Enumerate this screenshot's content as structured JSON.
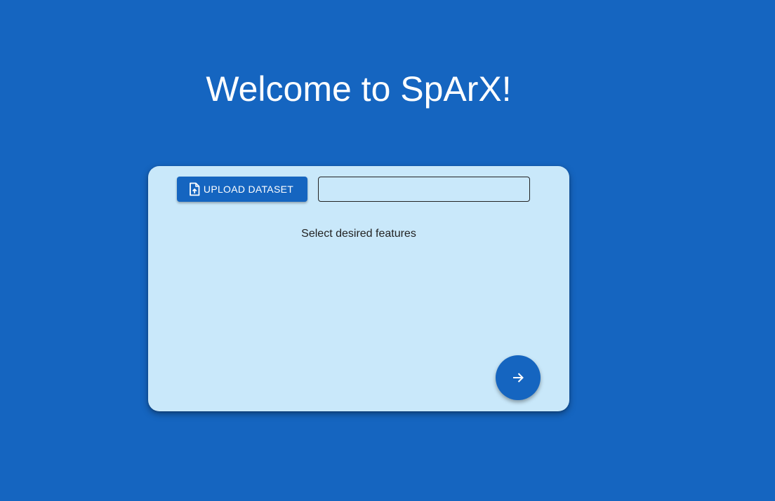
{
  "header": {
    "title": "Welcome to SpArX!"
  },
  "card": {
    "upload_button": {
      "label": "UPLOAD DATASET",
      "icon": "file-upload-icon"
    },
    "file_name_input": {
      "value": "",
      "placeholder": ""
    },
    "features_label": "Select desired features",
    "next_button": {
      "icon": "arrow-right-icon"
    }
  },
  "colors": {
    "background": "#1565c0",
    "card_background": "#c9e8fa",
    "primary": "#1565c0",
    "text_dark": "#222222",
    "text_light": "#ffffff"
  }
}
